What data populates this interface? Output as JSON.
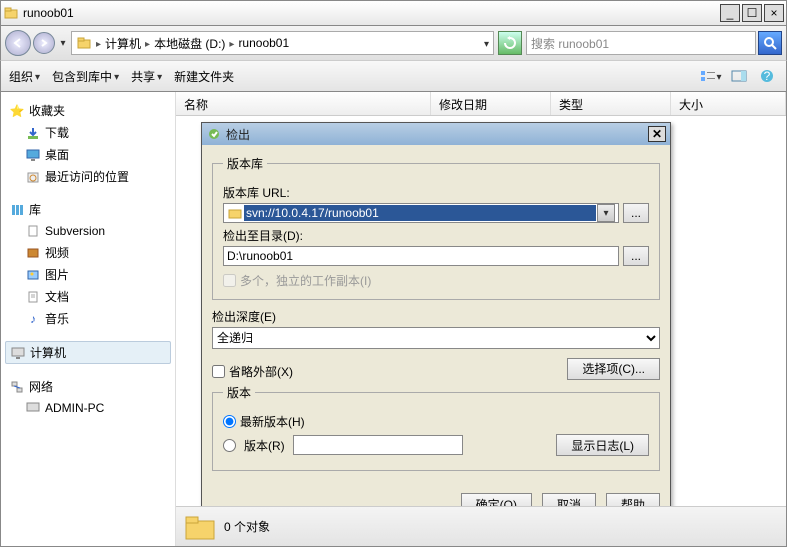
{
  "window": {
    "title": "runoob01",
    "min": "_",
    "max": "☐",
    "close": "×"
  },
  "nav": {
    "breadcrumb": [
      "计算机",
      "本地磁盘 (D:)",
      "runoob01"
    ],
    "search_placeholder": "搜索 runoob01"
  },
  "toolbar": {
    "organize": "组织",
    "include": "包含到库中",
    "share": "共享",
    "newfolder": "新建文件夹"
  },
  "columns": {
    "name": "名称",
    "date": "修改日期",
    "type": "类型",
    "size": "大小"
  },
  "sidebar": {
    "favorites": {
      "label": "收藏夹",
      "items": [
        "下载",
        "桌面",
        "最近访问的位置"
      ]
    },
    "libraries": {
      "label": "库",
      "items": [
        "Subversion",
        "视频",
        "图片",
        "文档",
        "音乐"
      ]
    },
    "computer": {
      "label": "计算机"
    },
    "network": {
      "label": "网络",
      "items": [
        "ADMIN-PC"
      ]
    }
  },
  "status": {
    "text": "0 个对象"
  },
  "dialog": {
    "title": "检出",
    "repo": {
      "legend": "版本库",
      "url_label": "版本库 URL:",
      "url_value": "svn://10.0.4.17/runoob01",
      "dir_label": "检出至目录(D):",
      "dir_value": "D:\\runoob01",
      "multi_label": "多个，独立的工作副本(I)"
    },
    "depth": {
      "label": "检出深度(E)",
      "value": "全递归",
      "omit_label": "省略外部(X)",
      "choose": "选择项(C)..."
    },
    "revision": {
      "legend": "版本",
      "head": "最新版本(H)",
      "rev": "版本(R)",
      "showlog": "显示日志(L)"
    },
    "buttons": {
      "ok": "确定(O)",
      "cancel": "取消",
      "help": "帮助"
    }
  }
}
